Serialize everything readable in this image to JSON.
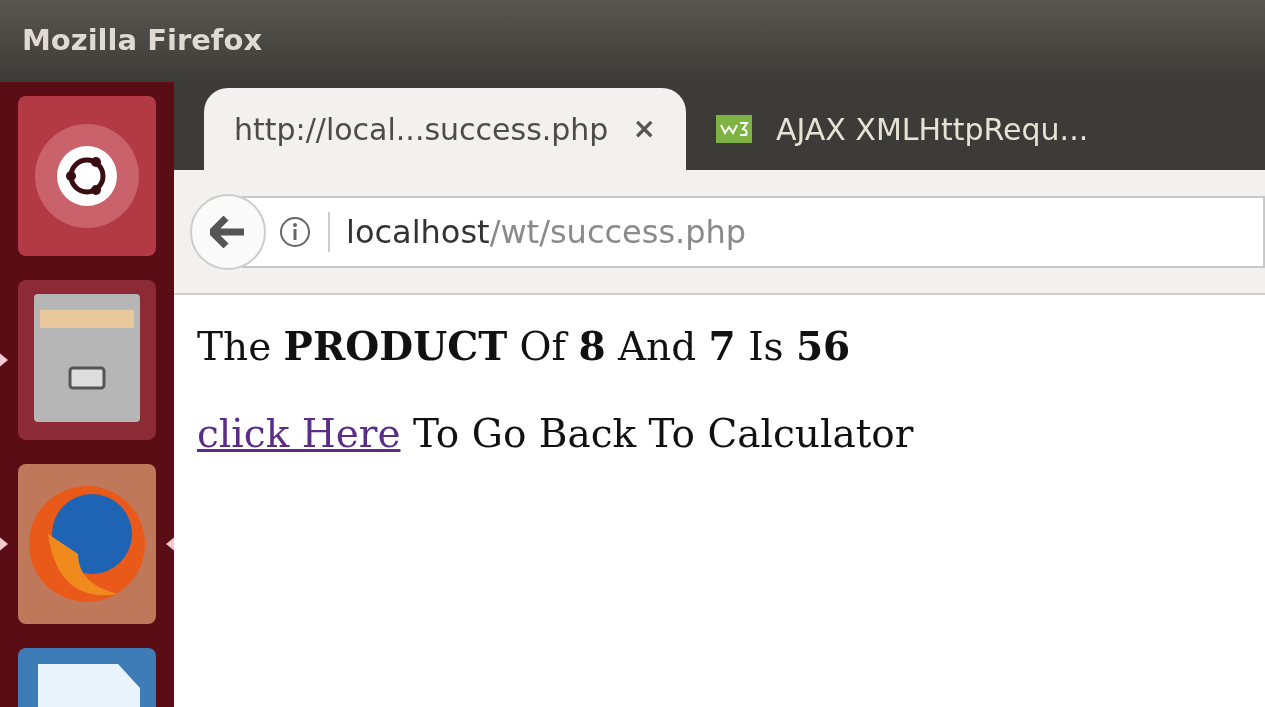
{
  "window": {
    "title": "Mozilla Firefox"
  },
  "launcher": {
    "items": [
      {
        "kind": "ubuntu",
        "running": false,
        "focused": false
      },
      {
        "kind": "files",
        "running": true,
        "focused": false
      },
      {
        "kind": "firefox",
        "running": true,
        "focused": true
      },
      {
        "kind": "writer",
        "running": false,
        "focused": false
      }
    ]
  },
  "tabs": [
    {
      "label": "http://local...success.php",
      "selected": true,
      "close": "×"
    },
    {
      "label": "AJAX XMLHttpRequ...",
      "selected": false
    }
  ],
  "address_bar": {
    "host": "localhost",
    "path": "/wt/success.php"
  },
  "page": {
    "result": "The **PRODUCT** Of **8** And **7** Is **56**",
    "link": {
      "text": "click Here",
      "visited": true
    },
    "link_rest": "To Go Back To Calculator"
  }
}
